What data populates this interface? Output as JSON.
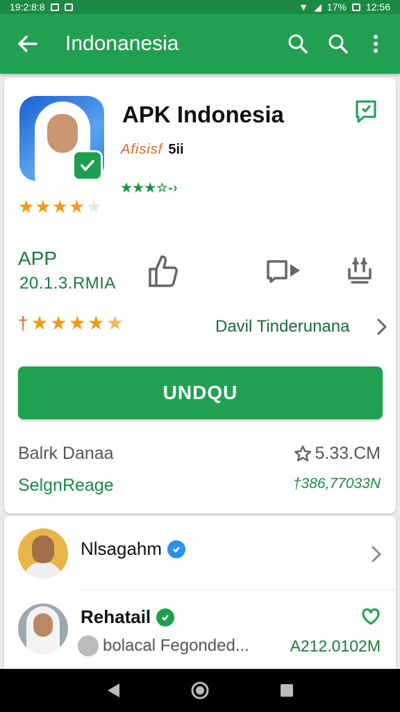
{
  "status_bar": {
    "time_left": "19:2:8:8",
    "battery": "17%",
    "time_right": "12:56"
  },
  "app_bar": {
    "title": "Indonanesia"
  },
  "app": {
    "title": "APK Indonesia",
    "developer": "Afisisf",
    "version_short": "5ii",
    "mini_rating": "★★★☆-›",
    "type_label": "APP",
    "version": "20.1.3.RMIA",
    "rating_prefix": "†",
    "author": "Davil Tinderunana",
    "download_label": "UNDQU",
    "info_left_1": "Balrk Danaa",
    "info_right_1": "5.33.CM",
    "info_left_2": "SelgnReage",
    "info_right_2": "†386,77033N"
  },
  "list": [
    {
      "name": "Nlsagahm"
    },
    {
      "name": "Rehatail",
      "subtitle": "bolacal Fegonded...",
      "size": "A212.0102M"
    }
  ],
  "colors": {
    "primary": "#22a052",
    "accent_orange": "#f29a1a"
  }
}
